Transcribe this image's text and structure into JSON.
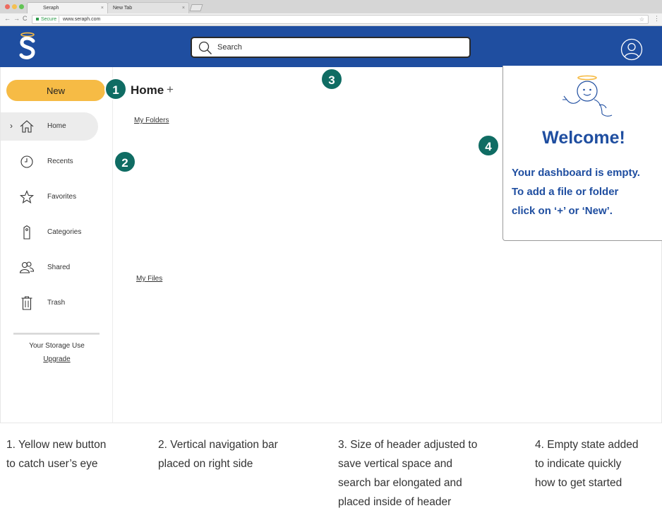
{
  "browser": {
    "tabs": [
      {
        "label": "Seraph",
        "close": "×"
      },
      {
        "label": "New Tab",
        "close": "×"
      }
    ],
    "nav": {
      "back": "←",
      "forward": "→",
      "reload": "C"
    },
    "secure_label": "Secure",
    "url": "www.seraph.com",
    "bookmark_glyph": "☆",
    "menu_glyph": "⋮"
  },
  "header": {
    "logo_icon": "seraph-logo-icon",
    "search_placeholder": "Search",
    "avatar_icon": "user-avatar-icon",
    "background": "#1f4ea0"
  },
  "sidebar": {
    "new_button": "New",
    "new_button_color": "#f6bb45",
    "items": [
      {
        "label": "Home",
        "icon": "home-icon",
        "active": true,
        "chevron": "›"
      },
      {
        "label": "Recents",
        "icon": "clock-icon"
      },
      {
        "label": "Favorites",
        "icon": "star-icon"
      },
      {
        "label": "Categories",
        "icon": "tag-icon"
      },
      {
        "label": "Shared",
        "icon": "users-icon"
      },
      {
        "label": "Trash",
        "icon": "trash-icon"
      }
    ],
    "storage_label": "Your Storage Use",
    "upgrade_label": "Upgrade"
  },
  "main": {
    "title": "Home",
    "add_glyph": "+",
    "folders_label": "My Folders",
    "files_label": "My Files"
  },
  "welcome": {
    "title": "Welcome!",
    "lines": [
      "Your dashboard is empty.",
      "To add a file or folder",
      "click on ‘+’ or ‘New’."
    ],
    "accent": "#1f4ea0"
  },
  "badges": [
    "1",
    "2",
    "3",
    "4"
  ],
  "badge_color": "#0f6c63",
  "annotations": [
    {
      "lines": [
        "1. Yellow new button",
        "to catch user’s eye"
      ]
    },
    {
      "lines": [
        "2. Vertical navigation bar",
        "placed on right side"
      ]
    },
    {
      "lines": [
        "3. Size of header adjusted to",
        "save vertical space and",
        "search bar elongated and",
        "placed inside of header"
      ]
    },
    {
      "lines": [
        "4. Empty state added",
        "to indicate quickly",
        "how to get started"
      ]
    }
  ]
}
